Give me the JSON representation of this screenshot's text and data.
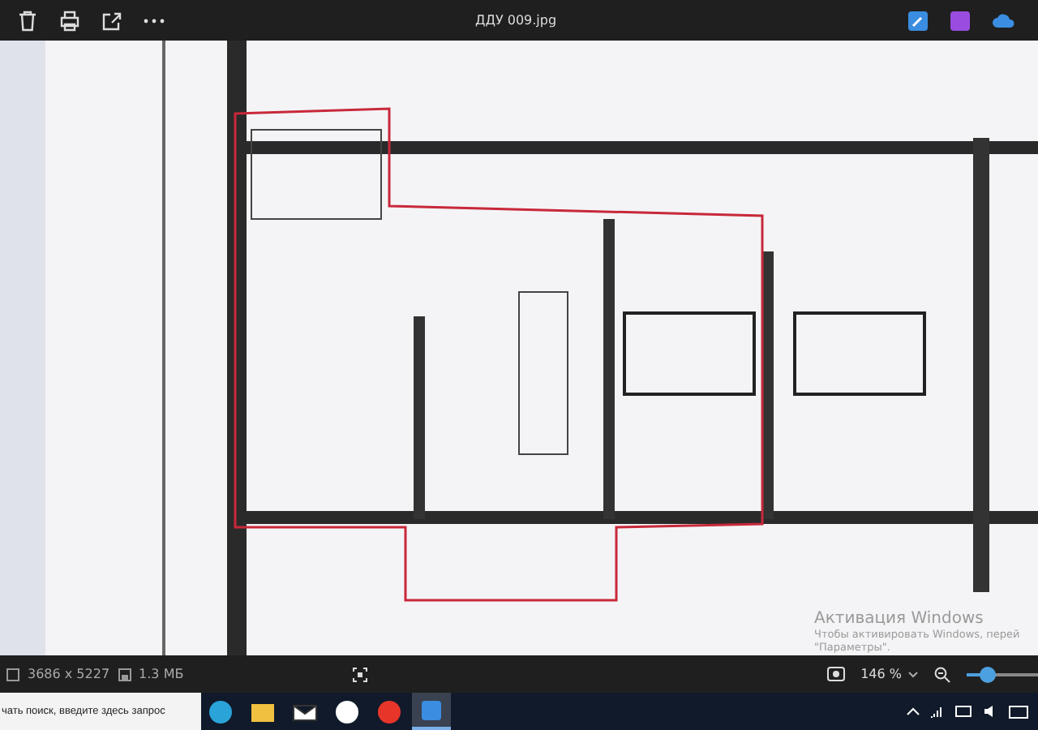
{
  "window": {
    "title": "ДДУ 009.jpg"
  },
  "activation": {
    "title": "Активация Windows",
    "line_1": "Чтобы активировать Windows, перей",
    "line_2": "\"Параметры\"."
  },
  "status_bar": {
    "dimensions": "3686 x 5227",
    "size": "1.3 МБ",
    "zoom": "146 %",
    "zoom_slider": {
      "level": 0.3
    }
  },
  "taskbar": {
    "search": {
      "placeholder": "чать поиск, введите здесь запрос"
    },
    "apps": [
      {
        "selected": false
      },
      {
        "selected": false
      },
      {
        "selected": false
      },
      {
        "selected": false
      },
      {
        "selected": false
      },
      {
        "selected": true
      }
    ]
  }
}
